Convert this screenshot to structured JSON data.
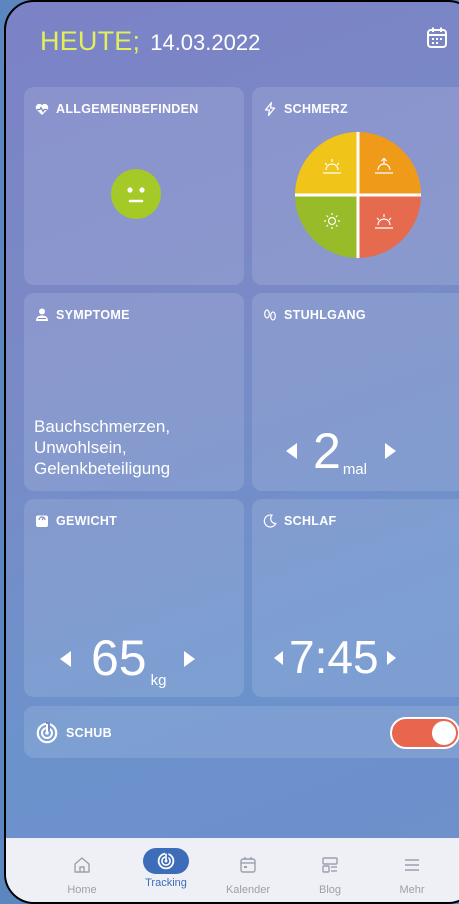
{
  "header": {
    "today_label": "HEUTE;",
    "date": "14.03.2022",
    "calendar_icon": "calendar-icon"
  },
  "cards": {
    "allgemeinbefinden": {
      "title": "ALLGEMEINBEFINDEN",
      "icon": "heart-pulse-icon",
      "mood_color": "#a5c927"
    },
    "schmerz": {
      "title": "SCHMERZ",
      "icon": "lightning-icon",
      "quadrant_colors": [
        "#f0c419",
        "#f09a1a",
        "#e56a4e",
        "#98bb2a"
      ]
    },
    "symptome": {
      "title": "SYMPTOME",
      "icon": "person-icon",
      "lines": [
        "Bauchschmerzen,",
        "Unwohlsein,",
        "Gelenkbeteiligung"
      ]
    },
    "stuhlgang": {
      "title": "STUHLGANG",
      "icon": "footprints-icon",
      "value": "2",
      "unit": "mal"
    },
    "gewicht": {
      "title": "GEWICHT",
      "icon": "scale-icon",
      "value": "65",
      "unit": "kg"
    },
    "schlaf": {
      "title": "SCHLAF",
      "icon": "moon-icon",
      "value": "7:45"
    },
    "schub": {
      "title": "SCHUB",
      "icon": "flare-target-icon",
      "toggle_on": true
    }
  },
  "nav": {
    "items": [
      {
        "label": "Home",
        "icon": "home-icon"
      },
      {
        "label": "Tracking",
        "icon": "tracking-icon"
      },
      {
        "label": "Kalender",
        "icon": "calendar-icon"
      },
      {
        "label": "Blog",
        "icon": "blog-icon"
      },
      {
        "label": "Mehr",
        "icon": "menu-icon"
      }
    ],
    "active_index": 1,
    "active_color": "#3d6db8"
  },
  "colors": {
    "today": "#e3ef5a",
    "toggle": "#e8654e"
  }
}
